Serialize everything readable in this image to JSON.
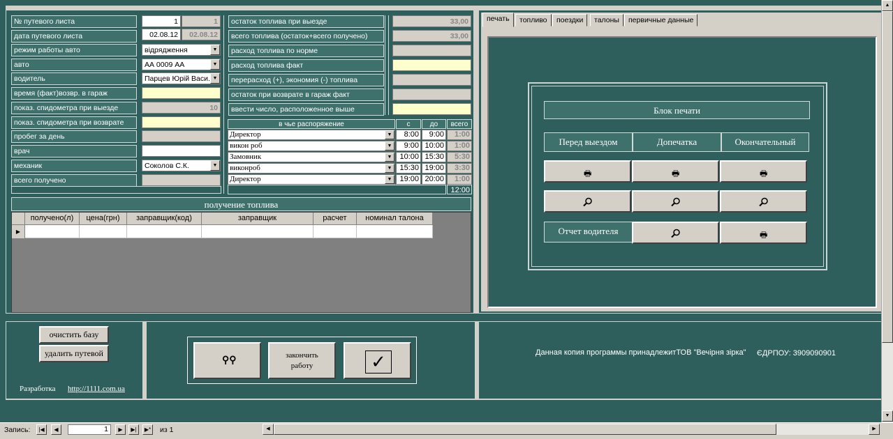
{
  "left_form": {
    "labels": [
      "№ путевого листа",
      "дата путевого листа",
      "режим работы авто",
      "авто",
      "водитель",
      "время (факт)возвр. в гараж",
      "показ. спидометра при выезде",
      "показ. спидометра при возврате",
      "пробег за день",
      "врач",
      "механик",
      "всего получено"
    ],
    "waybill_no": "1",
    "waybill_no_gray": "1",
    "date": "02.08.12",
    "date_gray": "02.08.12",
    "mode": "відрядження",
    "auto": "АА 0009 АА",
    "driver": "Парцев Юрій Васи...",
    "odometer_out": "10",
    "mechanic": "Соколов С.К."
  },
  "fuel_form": {
    "labels": [
      "остаток топлива при выезде",
      "всего топлива (остаток+всего получено)",
      "расход топлива по норме",
      "расход топлива факт",
      "перерасход (+), экономия (-) топлива",
      "остаток при возврате в гараж  факт",
      "ввести число, расположенное выше"
    ],
    "fuel_at_departure": "33,00",
    "fuel_total": "33,00"
  },
  "disposal": {
    "headers": [
      "в чье распоряжение",
      "с",
      "до",
      "всего"
    ],
    "rows": [
      {
        "who": "Директор",
        "from": "8:00",
        "to": "9:00",
        "total": "1:00"
      },
      {
        "who": "викон роб",
        "from": "9:00",
        "to": "10:00",
        "total": "1:00"
      },
      {
        "who": "Замовник",
        "from": "10:00",
        "to": "15:30",
        "total": "5:30"
      },
      {
        "who": "виконроб",
        "from": "15:30",
        "to": "19:00",
        "total": "3:30"
      },
      {
        "who": "Директор",
        "from": "19:00",
        "to": "20:00",
        "total": "1:00"
      }
    ],
    "sum_total": "12:00"
  },
  "fuel_receipt": {
    "title": "получение топлива",
    "columns": [
      "получено(л)",
      "цена(грн)",
      "заправщик(код)",
      "заправщик",
      "расчет",
      "номинал талона"
    ]
  },
  "tabs": [
    "печать",
    "топливо",
    "поездки",
    "талоны",
    "первичные данные"
  ],
  "print_block": {
    "title": "Блок печати",
    "columns": [
      "Перед выездом",
      "Допечатка",
      "Окончательный"
    ],
    "driver_report": "Отчет водителя"
  },
  "bottom_left": {
    "clear_db": "очистить базу",
    "delete_waybill": "удалить путевой",
    "dev_label": "Разработка",
    "dev_link": "http://1111.com.ua"
  },
  "bottom_center": {
    "finish_line1": "закончить",
    "finish_line2": "работу"
  },
  "license": {
    "text": "Данная копия программы принадлежитТОВ \"Вечірня зірка\"",
    "edrpou": "ЄДРПОУ: 3909090901"
  },
  "status_bar": {
    "record_label": "Запись:",
    "record_value": "1",
    "of_label": "из  1"
  }
}
